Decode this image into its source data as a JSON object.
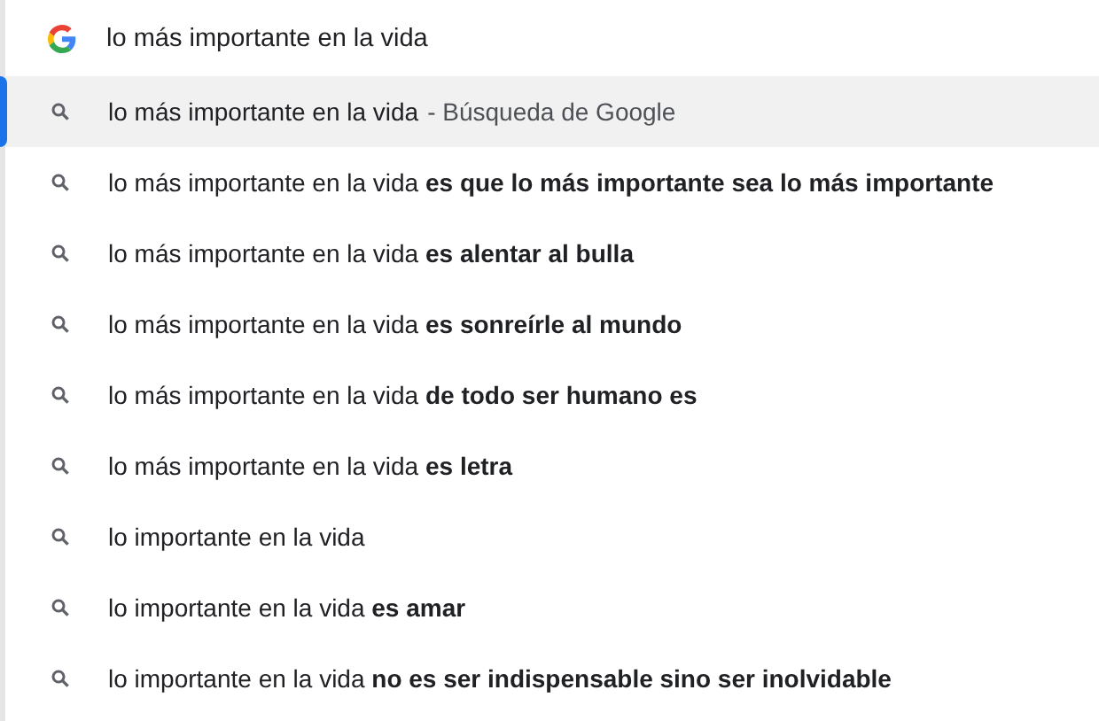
{
  "search": {
    "value": "lo más importante en la vida"
  },
  "suggestions": [
    {
      "text": "lo más importante en la vida",
      "suffix": "- Búsqueda de Google",
      "selected": true
    },
    {
      "text": "lo más importante en la vida **es que lo más importante sea lo más importante**",
      "selected": false
    },
    {
      "text": "lo más importante en la vida **es alentar al bulla**",
      "selected": false
    },
    {
      "text": "lo más importante en la vida **es sonreírle al mundo**",
      "selected": false
    },
    {
      "text": "lo más importante en la vida **de todo ser humano es**",
      "selected": false
    },
    {
      "text": "lo más importante en la vida **es letra**",
      "selected": false
    },
    {
      "text": "lo importante en la vida",
      "selected": false
    },
    {
      "text": "lo importante en la vida **es amar**",
      "selected": false
    },
    {
      "text": "lo importante en la vida **no es ser indispensable sino ser inolvidable**",
      "selected": false
    }
  ]
}
